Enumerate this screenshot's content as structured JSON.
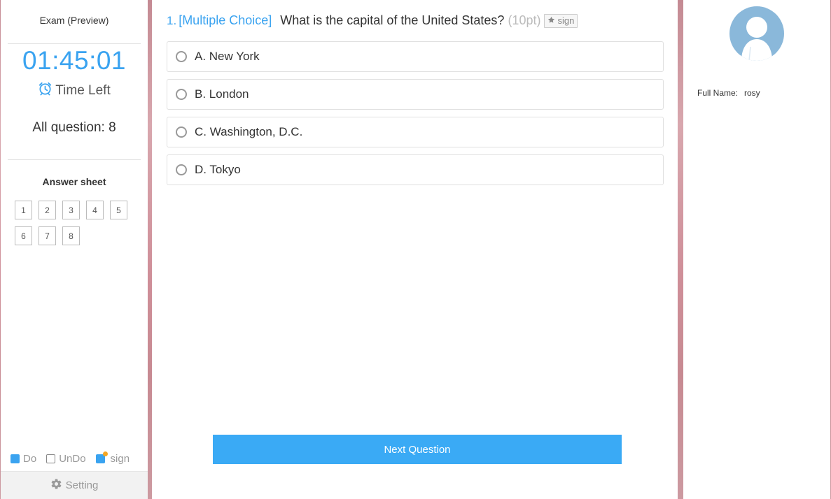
{
  "sidebar": {
    "exam_title": "Exam (Preview)",
    "timer": "01:45:01",
    "time_left_label": "Time Left",
    "all_question_label": "All question: 8",
    "answer_sheet_title": "Answer sheet",
    "sheet_numbers": [
      "1",
      "2",
      "3",
      "4",
      "5",
      "6",
      "7",
      "8"
    ],
    "legend": {
      "do": "Do",
      "undo": "UnDo",
      "sign": "sign"
    },
    "setting_label": "Setting",
    "icons": {
      "time_left": "alarm-clock-icon",
      "setting": "gear-icon"
    }
  },
  "question": {
    "number": "1.",
    "type": "[Multiple Choice]",
    "text": "What is the capital of the United States?",
    "points": "(10pt)",
    "sign_label": "sign",
    "sign_icon": "star-icon",
    "options": [
      {
        "label": "A. New York"
      },
      {
        "label": "B. London"
      },
      {
        "label": "C. Washington, D.C."
      },
      {
        "label": "D. Tokyo"
      }
    ],
    "next_label": "Next Question"
  },
  "profile": {
    "full_name_label": "Full Name:",
    "full_name_value": "rosy"
  },
  "colors": {
    "accent": "#3aa3f0",
    "button": "#3aaaf5",
    "avatar": "#8ab8da",
    "sign_dot": "#f5a623"
  }
}
